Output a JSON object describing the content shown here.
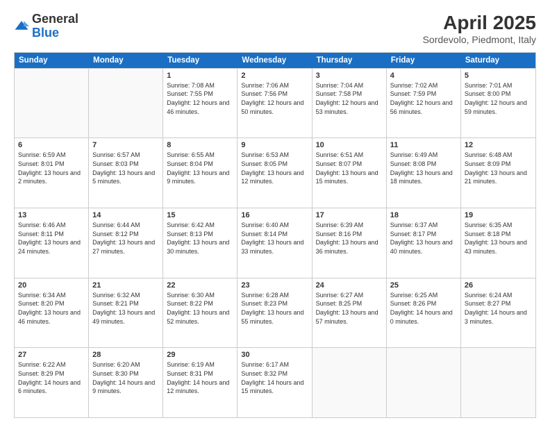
{
  "header": {
    "logo_general": "General",
    "logo_blue": "Blue",
    "title": "April 2025",
    "location": "Sordevolo, Piedmont, Italy"
  },
  "weekdays": [
    "Sunday",
    "Monday",
    "Tuesday",
    "Wednesday",
    "Thursday",
    "Friday",
    "Saturday"
  ],
  "rows": [
    [
      {
        "day": "",
        "text": ""
      },
      {
        "day": "",
        "text": ""
      },
      {
        "day": "1",
        "text": "Sunrise: 7:08 AM\nSunset: 7:55 PM\nDaylight: 12 hours and 46 minutes."
      },
      {
        "day": "2",
        "text": "Sunrise: 7:06 AM\nSunset: 7:56 PM\nDaylight: 12 hours and 50 minutes."
      },
      {
        "day": "3",
        "text": "Sunrise: 7:04 AM\nSunset: 7:58 PM\nDaylight: 12 hours and 53 minutes."
      },
      {
        "day": "4",
        "text": "Sunrise: 7:02 AM\nSunset: 7:59 PM\nDaylight: 12 hours and 56 minutes."
      },
      {
        "day": "5",
        "text": "Sunrise: 7:01 AM\nSunset: 8:00 PM\nDaylight: 12 hours and 59 minutes."
      }
    ],
    [
      {
        "day": "6",
        "text": "Sunrise: 6:59 AM\nSunset: 8:01 PM\nDaylight: 13 hours and 2 minutes."
      },
      {
        "day": "7",
        "text": "Sunrise: 6:57 AM\nSunset: 8:03 PM\nDaylight: 13 hours and 5 minutes."
      },
      {
        "day": "8",
        "text": "Sunrise: 6:55 AM\nSunset: 8:04 PM\nDaylight: 13 hours and 9 minutes."
      },
      {
        "day": "9",
        "text": "Sunrise: 6:53 AM\nSunset: 8:05 PM\nDaylight: 13 hours and 12 minutes."
      },
      {
        "day": "10",
        "text": "Sunrise: 6:51 AM\nSunset: 8:07 PM\nDaylight: 13 hours and 15 minutes."
      },
      {
        "day": "11",
        "text": "Sunrise: 6:49 AM\nSunset: 8:08 PM\nDaylight: 13 hours and 18 minutes."
      },
      {
        "day": "12",
        "text": "Sunrise: 6:48 AM\nSunset: 8:09 PM\nDaylight: 13 hours and 21 minutes."
      }
    ],
    [
      {
        "day": "13",
        "text": "Sunrise: 6:46 AM\nSunset: 8:11 PM\nDaylight: 13 hours and 24 minutes."
      },
      {
        "day": "14",
        "text": "Sunrise: 6:44 AM\nSunset: 8:12 PM\nDaylight: 13 hours and 27 minutes."
      },
      {
        "day": "15",
        "text": "Sunrise: 6:42 AM\nSunset: 8:13 PM\nDaylight: 13 hours and 30 minutes."
      },
      {
        "day": "16",
        "text": "Sunrise: 6:40 AM\nSunset: 8:14 PM\nDaylight: 13 hours and 33 minutes."
      },
      {
        "day": "17",
        "text": "Sunrise: 6:39 AM\nSunset: 8:16 PM\nDaylight: 13 hours and 36 minutes."
      },
      {
        "day": "18",
        "text": "Sunrise: 6:37 AM\nSunset: 8:17 PM\nDaylight: 13 hours and 40 minutes."
      },
      {
        "day": "19",
        "text": "Sunrise: 6:35 AM\nSunset: 8:18 PM\nDaylight: 13 hours and 43 minutes."
      }
    ],
    [
      {
        "day": "20",
        "text": "Sunrise: 6:34 AM\nSunset: 8:20 PM\nDaylight: 13 hours and 46 minutes."
      },
      {
        "day": "21",
        "text": "Sunrise: 6:32 AM\nSunset: 8:21 PM\nDaylight: 13 hours and 49 minutes."
      },
      {
        "day": "22",
        "text": "Sunrise: 6:30 AM\nSunset: 8:22 PM\nDaylight: 13 hours and 52 minutes."
      },
      {
        "day": "23",
        "text": "Sunrise: 6:28 AM\nSunset: 8:23 PM\nDaylight: 13 hours and 55 minutes."
      },
      {
        "day": "24",
        "text": "Sunrise: 6:27 AM\nSunset: 8:25 PM\nDaylight: 13 hours and 57 minutes."
      },
      {
        "day": "25",
        "text": "Sunrise: 6:25 AM\nSunset: 8:26 PM\nDaylight: 14 hours and 0 minutes."
      },
      {
        "day": "26",
        "text": "Sunrise: 6:24 AM\nSunset: 8:27 PM\nDaylight: 14 hours and 3 minutes."
      }
    ],
    [
      {
        "day": "27",
        "text": "Sunrise: 6:22 AM\nSunset: 8:29 PM\nDaylight: 14 hours and 6 minutes."
      },
      {
        "day": "28",
        "text": "Sunrise: 6:20 AM\nSunset: 8:30 PM\nDaylight: 14 hours and 9 minutes."
      },
      {
        "day": "29",
        "text": "Sunrise: 6:19 AM\nSunset: 8:31 PM\nDaylight: 14 hours and 12 minutes."
      },
      {
        "day": "30",
        "text": "Sunrise: 6:17 AM\nSunset: 8:32 PM\nDaylight: 14 hours and 15 minutes."
      },
      {
        "day": "",
        "text": ""
      },
      {
        "day": "",
        "text": ""
      },
      {
        "day": "",
        "text": ""
      }
    ]
  ]
}
